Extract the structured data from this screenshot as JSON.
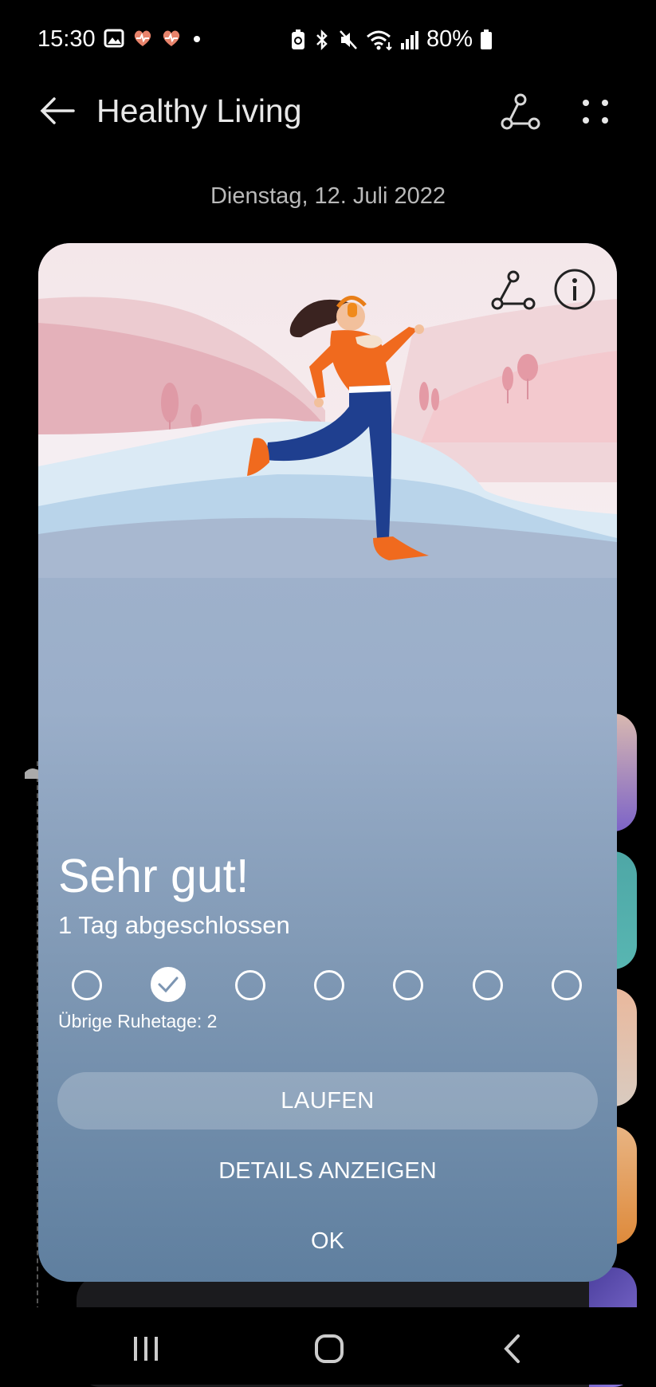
{
  "status": {
    "time": "15:30",
    "battery": "80%",
    "left_icons": [
      "gallery-icon",
      "heart-rate-icon",
      "heart-rate-icon",
      "dot-icon"
    ],
    "right_icons": [
      "battery-saver-icon",
      "bluetooth-icon",
      "mute-icon",
      "wifi-icon",
      "signal-icon",
      "battery-icon"
    ]
  },
  "app": {
    "title": "Healthy Living",
    "date": "Dienstag, 12. Juli 2022"
  },
  "modal": {
    "headline": "Sehr gut!",
    "subline": "1 Tag abgeschlossen",
    "days_total": 7,
    "days_completed_index": [
      1
    ],
    "rest_days": "Übrige Ruhetage: 2",
    "primary_button": "LAUFEN",
    "details_button": "DETAILS ANZEIGEN",
    "ok_button": "OK"
  },
  "colors": {
    "accent_orange": "#f06a1e",
    "pants_blue": "#1f3f8f",
    "pink_hill": "#e9b9be",
    "sky_top": "#f4e7ea"
  }
}
